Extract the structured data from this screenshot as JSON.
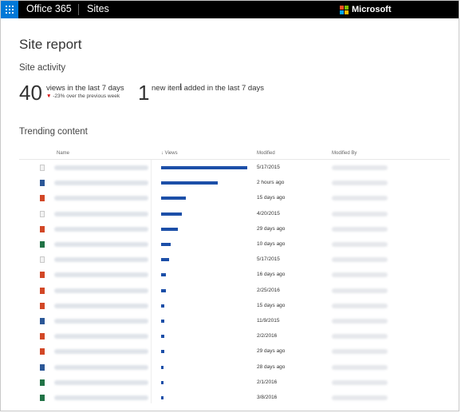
{
  "topbar": {
    "app_name": "Office 365",
    "site_label": "Sites",
    "vendor": "Microsoft"
  },
  "report": {
    "title": "Site report",
    "activity_heading": "Site activity",
    "views_count": "40",
    "views_label": "views in the last 7 days",
    "views_change": "-23% over the previous week",
    "new_count": "1",
    "new_label": "new item added in the last 7 days",
    "trending_heading": "Trending content"
  },
  "table": {
    "columns": [
      "Name",
      "Views",
      "Modified",
      "Modified By"
    ],
    "sort_indicator": "↓",
    "rows": [
      {
        "icon": "doc",
        "views": 100,
        "modified": "5/17/2015"
      },
      {
        "icon": "word",
        "views": 66,
        "modified": "2 hours ago"
      },
      {
        "icon": "ppt",
        "views": 29,
        "modified": "15 days ago"
      },
      {
        "icon": "doc",
        "views": 24,
        "modified": "4/20/2015"
      },
      {
        "icon": "ppt",
        "views": 19,
        "modified": "29 days ago"
      },
      {
        "icon": "excel",
        "views": 11,
        "modified": "10 days ago"
      },
      {
        "icon": "doc",
        "views": 9,
        "modified": "5/17/2015"
      },
      {
        "icon": "ppt",
        "views": 6,
        "modified": "16 days ago"
      },
      {
        "icon": "ppt",
        "views": 6,
        "modified": "2/25/2016"
      },
      {
        "icon": "ppt",
        "views": 4,
        "modified": "15 days ago"
      },
      {
        "icon": "word",
        "views": 4,
        "modified": "11/9/2015"
      },
      {
        "icon": "ppt",
        "views": 4,
        "modified": "2/2/2016"
      },
      {
        "icon": "ppt",
        "views": 4,
        "modified": "29 days ago"
      },
      {
        "icon": "word",
        "views": 3,
        "modified": "28 days ago"
      },
      {
        "icon": "excel",
        "views": 2,
        "modified": "2/1/2016"
      },
      {
        "icon": "excel",
        "views": 2,
        "modified": "3/8/2016"
      }
    ]
  },
  "colors": {
    "accent": "#0078d7",
    "bar": "#1c4fa8",
    "down_arrow": "#d40000",
    "ms_red": "#f25022",
    "ms_green": "#7fba00",
    "ms_blue": "#00a4ef",
    "ms_yellow": "#ffb900"
  }
}
